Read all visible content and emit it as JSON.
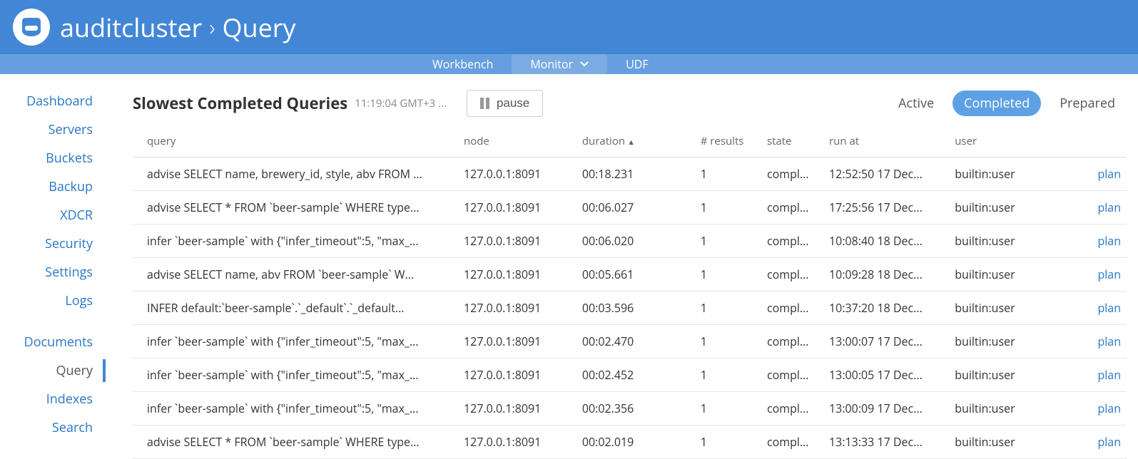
{
  "header": {
    "cluster_name": "auditcluster",
    "section": "Query"
  },
  "tabs": {
    "workbench": "Workbench",
    "monitor": "Monitor",
    "udf": "UDF"
  },
  "sidebar": {
    "group1": [
      "Dashboard",
      "Servers",
      "Buckets",
      "Backup",
      "XDCR",
      "Security",
      "Settings",
      "Logs"
    ],
    "group2": [
      "Documents",
      "Query",
      "Indexes",
      "Search"
    ],
    "current": "Query"
  },
  "page": {
    "title": "Slowest Completed Queries",
    "timestamp": "11:19:04 GMT+3 ...",
    "pause_label": "pause",
    "filters": {
      "active": "Active",
      "completed": "Completed",
      "prepared": "Prepared"
    }
  },
  "table": {
    "headers": {
      "query": "query",
      "node": "node",
      "duration": "duration",
      "results": "# results",
      "state": "state",
      "run_at": "run at",
      "user": "user"
    },
    "plan_label": "plan",
    "rows": [
      {
        "query": "advise SELECT name, brewery_id, style, abv FROM ...",
        "node": "127.0.0.1:8091",
        "duration": "00:18.231",
        "results": "1",
        "state": "compl...",
        "run_at": "12:52:50 17 Dec...",
        "user": "builtin:user"
      },
      {
        "query": "advise SELECT * FROM `beer-sample` WHERE type...",
        "node": "127.0.0.1:8091",
        "duration": "00:06.027",
        "results": "1",
        "state": "compl...",
        "run_at": "17:25:56 17 Dec...",
        "user": "builtin:user"
      },
      {
        "query": "infer `beer-sample` with {\"infer_timeout\":5, \"max_...",
        "node": "127.0.0.1:8091",
        "duration": "00:06.020",
        "results": "1",
        "state": "compl...",
        "run_at": "10:08:40 18 Dec...",
        "user": "builtin:user"
      },
      {
        "query": "advise SELECT name, abv FROM `beer-sample` W...",
        "node": "127.0.0.1:8091",
        "duration": "00:05.661",
        "results": "1",
        "state": "compl...",
        "run_at": "10:09:28 18 Dec...",
        "user": "builtin:user"
      },
      {
        "query": "INFER default:`beer-sample`.`_default`.`_default...",
        "node": "127.0.0.1:8091",
        "duration": "00:03.596",
        "results": "1",
        "state": "compl...",
        "run_at": "10:37:20 18 Dec...",
        "user": "builtin:user"
      },
      {
        "query": "infer `beer-sample` with {\"infer_timeout\":5, \"max_...",
        "node": "127.0.0.1:8091",
        "duration": "00:02.470",
        "results": "1",
        "state": "compl...",
        "run_at": "13:00:07 17 Dec...",
        "user": "builtin:user"
      },
      {
        "query": "infer `beer-sample` with {\"infer_timeout\":5, \"max_...",
        "node": "127.0.0.1:8091",
        "duration": "00:02.452",
        "results": "1",
        "state": "compl...",
        "run_at": "13:00:05 17 Dec...",
        "user": "builtin:user"
      },
      {
        "query": "infer `beer-sample` with {\"infer_timeout\":5, \"max_...",
        "node": "127.0.0.1:8091",
        "duration": "00:02.356",
        "results": "1",
        "state": "compl...",
        "run_at": "13:00:09 17 Dec...",
        "user": "builtin:user"
      },
      {
        "query": "advise SELECT * FROM `beer-sample` WHERE type...",
        "node": "127.0.0.1:8091",
        "duration": "00:02.019",
        "results": "1",
        "state": "compl...",
        "run_at": "13:13:33 17 Dec...",
        "user": "builtin:user"
      }
    ]
  }
}
